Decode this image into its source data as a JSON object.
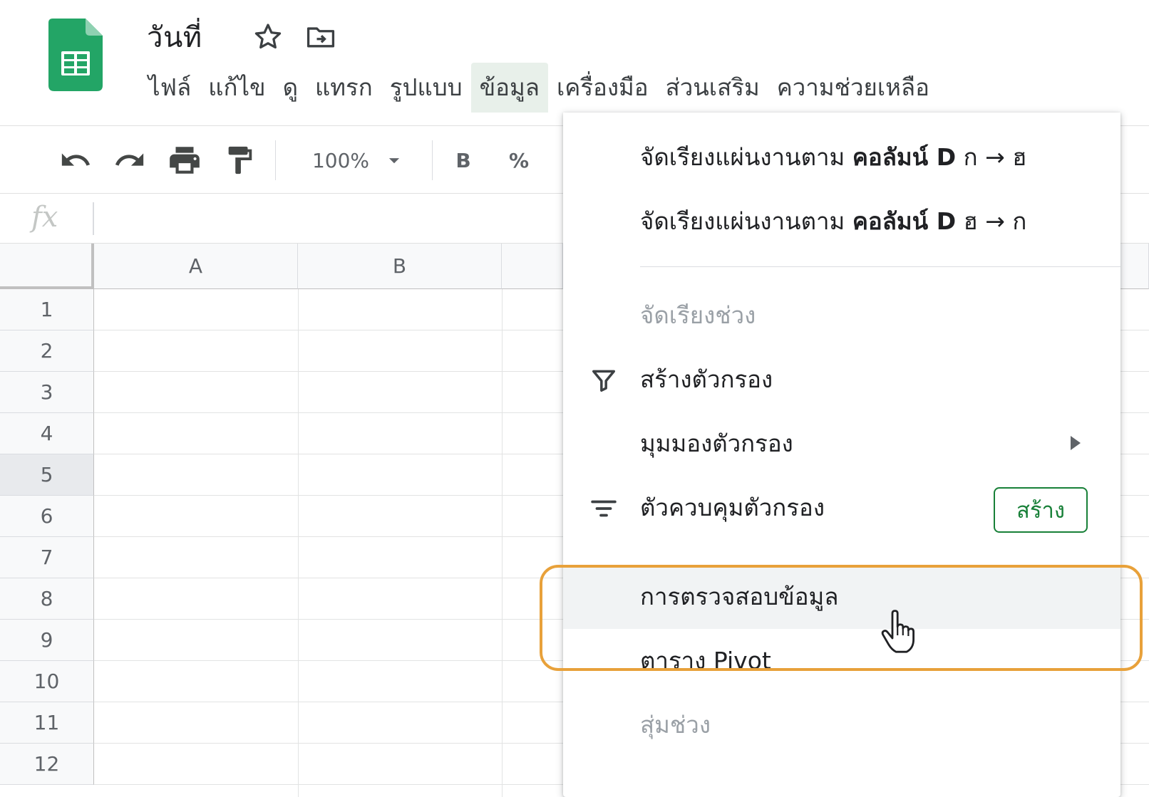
{
  "header": {
    "title": "วันที่",
    "icons": {
      "logo": "sheets-logo-icon",
      "star": "star-icon",
      "move": "folder-move-icon"
    }
  },
  "menu": {
    "items": [
      {
        "label": "ไฟล์"
      },
      {
        "label": "แก้ไข"
      },
      {
        "label": "ดู"
      },
      {
        "label": "แทรก"
      },
      {
        "label": "รูปแบบ"
      },
      {
        "label": "ข้อมูล",
        "active": true
      },
      {
        "label": "เครื่องมือ"
      },
      {
        "label": "ส่วนเสริม"
      },
      {
        "label": "ความช่วยเหลือ"
      }
    ]
  },
  "toolbar": {
    "zoom": "100%",
    "bold_label": "B",
    "percent_label": "%",
    "icons": [
      "undo-icon",
      "redo-icon",
      "print-icon",
      "paint-format-icon",
      "chevron-down-icon"
    ]
  },
  "formula_bar": {
    "fx_label": "fx",
    "value": ""
  },
  "grid": {
    "columns": [
      "A",
      "B"
    ],
    "rows": [
      "1",
      "2",
      "3",
      "4",
      "5",
      "6",
      "7",
      "8",
      "9",
      "10",
      "11",
      "12"
    ],
    "selected_row": "5"
  },
  "data_menu": {
    "sort_az": {
      "prefix": "จัดเรียงแผ่นงานตาม",
      "column": "คอลัมน์ D",
      "suffix": "ก → ฮ"
    },
    "sort_za": {
      "prefix": "จัดเรียงแผ่นงานตาม",
      "column": "คอลัมน์ D",
      "suffix": "ฮ → ก"
    },
    "sort_range": "จัดเรียงช่วง",
    "create_filter": "สร้างตัวกรอง",
    "filter_views": "มุมมองตัวกรอง",
    "slicer": "ตัวควบคุมตัวกรอง",
    "slicer_create_button": "สร้าง",
    "data_validation": "การตรวจสอบข้อมูล",
    "pivot_table": "ตาราง Pivot",
    "randomize_range": "สุ่มช่วง",
    "icons": [
      "filter-icon",
      "slicer-icon",
      "submenu-arrow-icon",
      "hand-cursor-icon"
    ],
    "accent_color": "#188038",
    "highlight_color": "#e8a13a"
  }
}
